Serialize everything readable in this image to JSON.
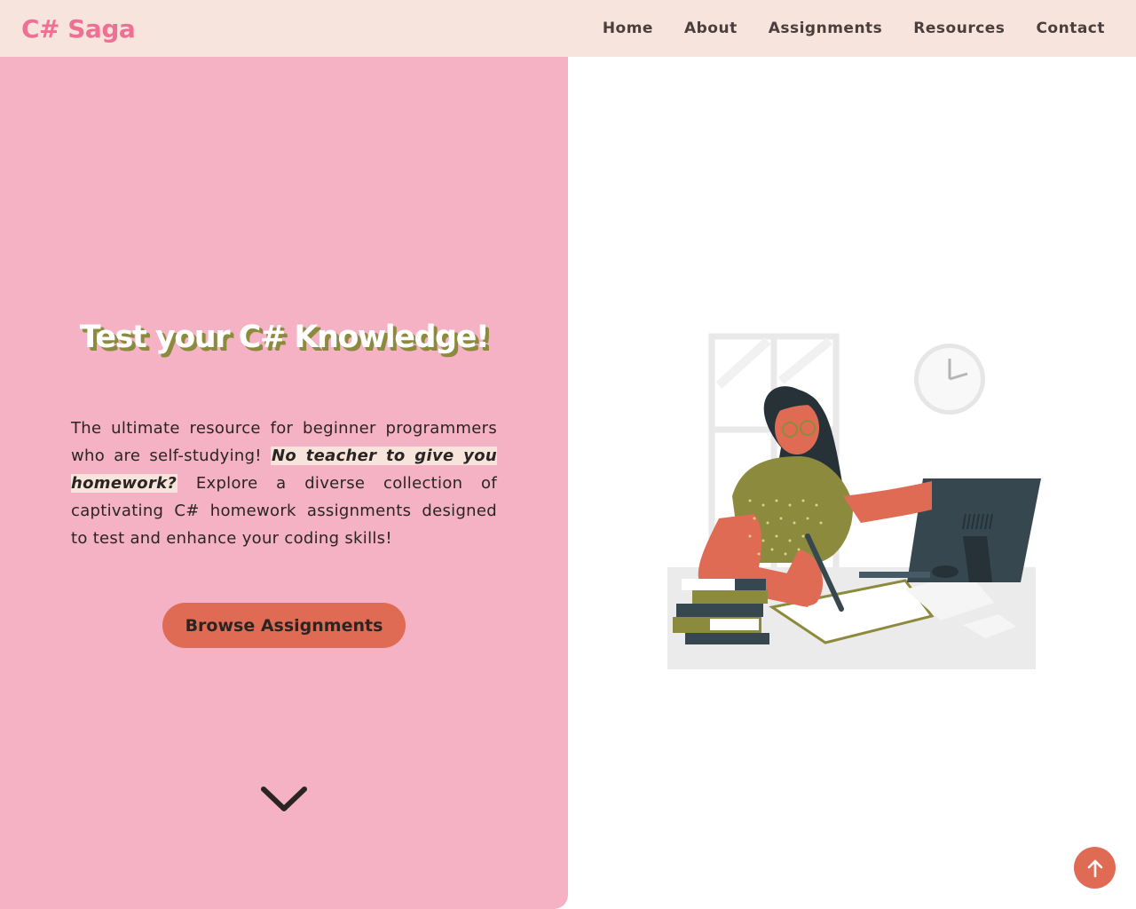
{
  "nav": {
    "logo": "C# Saga",
    "links": [
      "Home",
      "About",
      "Assignments",
      "Resources",
      "Contact"
    ]
  },
  "hero": {
    "title": "Test your C# Knowledge!",
    "desc_part1": "The ultimate resource for beginner programmers who are self-studying! ",
    "desc_highlight": "No teacher to give you homework?",
    "desc_part2": " Explore a diverse collection of captivating C# homework assignments designed to test and enhance your coding skills!",
    "button_label": "Browse Assignments",
    "scroll_icon": "chevron-down-icon"
  },
  "back_to_top_icon": "arrow-up-icon",
  "colors": {
    "nav_bg": "#f7e4dc",
    "logo": "#ee7195",
    "hero_bg": "#f4b2c4",
    "accent": "#e06b55",
    "title_shadow": "#8c8a3c",
    "text": "#2a2523"
  }
}
